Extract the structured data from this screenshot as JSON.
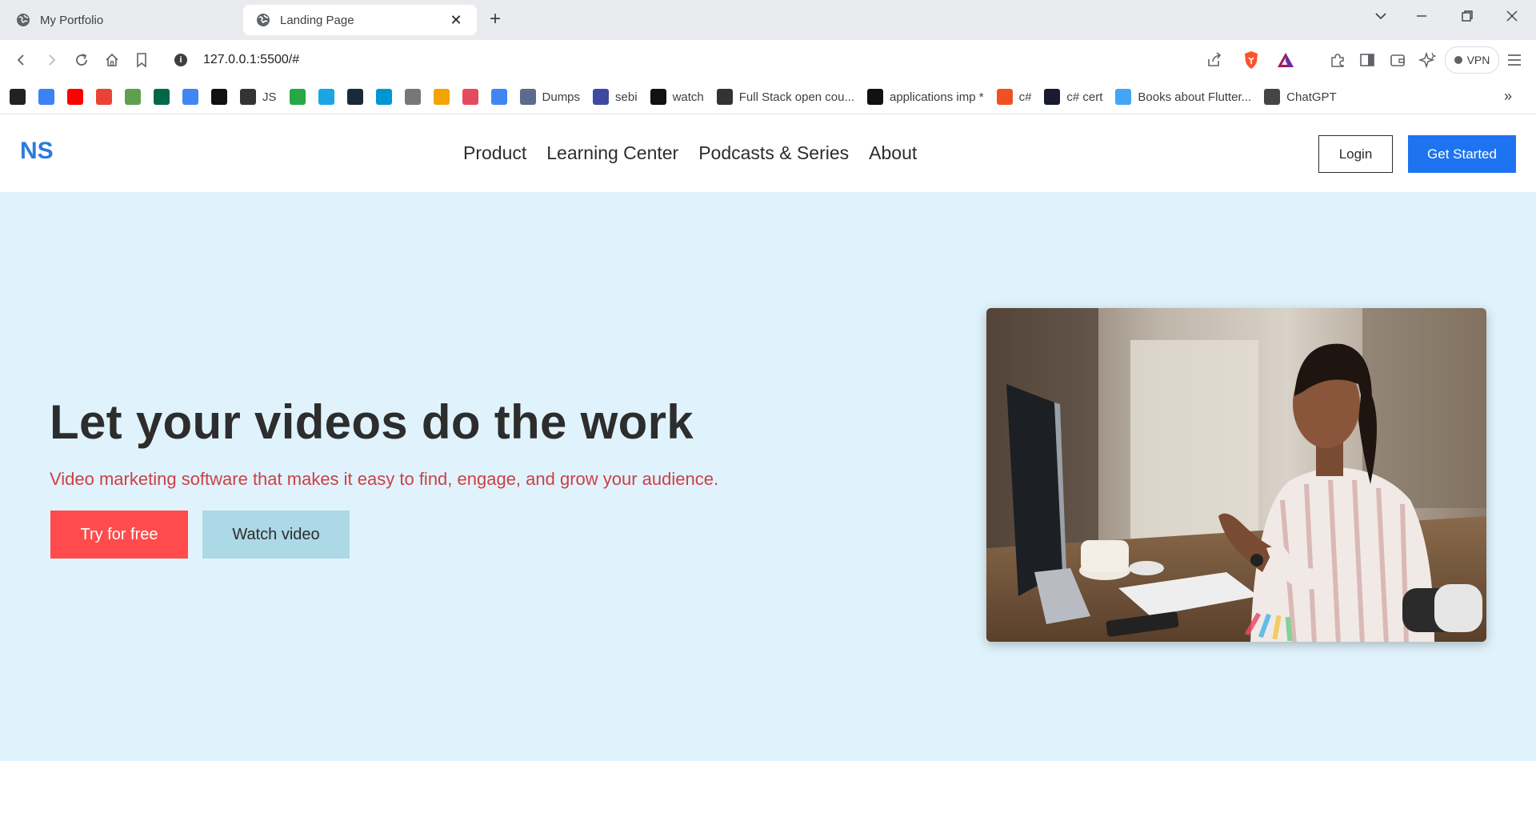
{
  "browser": {
    "tabs": [
      {
        "title": "My Portfolio",
        "active": false
      },
      {
        "title": "Landing Page",
        "active": true
      }
    ],
    "url": "127.0.0.1:5500/#",
    "vpn_label": "VPN",
    "bookmarks": [
      {
        "label": "",
        "icon": "dark-app-icon",
        "color": "#222222"
      },
      {
        "label": "",
        "icon": "gemini-star-icon",
        "color": "#3b82f6"
      },
      {
        "label": "",
        "icon": "youtube-icon",
        "color": "#ff0000"
      },
      {
        "label": "",
        "icon": "gmail-icon",
        "color": "#ea4335"
      },
      {
        "label": "",
        "icon": "nodejs-hex-icon",
        "color": "#5fa04e"
      },
      {
        "label": "",
        "icon": "mongodb-leaf-icon",
        "color": "#00684a"
      },
      {
        "label": "",
        "icon": "google-icon",
        "color": "#4285f4"
      },
      {
        "label": "",
        "icon": "notion-icon",
        "color": "#111111"
      },
      {
        "label": "JS",
        "icon": "js-frame-icon",
        "color": "#333333"
      },
      {
        "label": "",
        "icon": "freecodecamp-icon",
        "color": "#27a844"
      },
      {
        "label": "",
        "icon": "pinwheel-icon",
        "color": "#1aa6e5"
      },
      {
        "label": "",
        "icon": "cc-icon",
        "color": "#1b2a3a"
      },
      {
        "label": "",
        "icon": "hp-icon",
        "color": "#0096d6"
      },
      {
        "label": "",
        "icon": "cube-icon",
        "color": "#777777"
      },
      {
        "label": "",
        "icon": "analytics-icon",
        "color": "#f4a300"
      },
      {
        "label": "",
        "icon": "circle-app-icon",
        "color": "#e64a5f"
      },
      {
        "label": "",
        "icon": "cloud-icon",
        "color": "#4285f4"
      },
      {
        "label": "Dumps",
        "icon": "c-icon",
        "color": "#5b6b8c"
      },
      {
        "label": "sebi",
        "icon": "nism-icon",
        "color": "#3d4aa0"
      },
      {
        "label": "watch",
        "icon": "amazon-icon",
        "color": "#111111"
      },
      {
        "label": "Full Stack open cou...",
        "icon": "square-icon",
        "color": "#333333"
      },
      {
        "label": "applications imp *",
        "icon": "m-icon",
        "color": "#111111"
      },
      {
        "label": "c#",
        "icon": "microsoft-icon",
        "color": "#f25022"
      },
      {
        "label": "c# cert",
        "icon": "angular-a-icon",
        "color": "#1a1a2e"
      },
      {
        "label": "Books about Flutter...",
        "icon": "flutter-icon",
        "color": "#42a5f5"
      },
      {
        "label": "ChatGPT",
        "icon": "chatgpt-icon",
        "color": "#444444"
      }
    ]
  },
  "header": {
    "logo": "NS",
    "nav": [
      "Product",
      "Learning Center",
      "Podcasts & Series",
      "About"
    ],
    "login_label": "Login",
    "get_started_label": "Get Started"
  },
  "hero": {
    "title": "Let your videos do the work",
    "subtitle": "Video marketing software that makes it easy to find, engage, and grow your audience.",
    "try_label": "Try for free",
    "watch_label": "Watch video",
    "image_icon": "woman-at-computer-photo"
  },
  "colors": {
    "brand_blue": "#1e74f0",
    "hero_bg": "#e0f3fc",
    "try_red": "#ff4b4b",
    "watch_blue": "#add8e6",
    "subtitle_red": "#cc3f47"
  }
}
